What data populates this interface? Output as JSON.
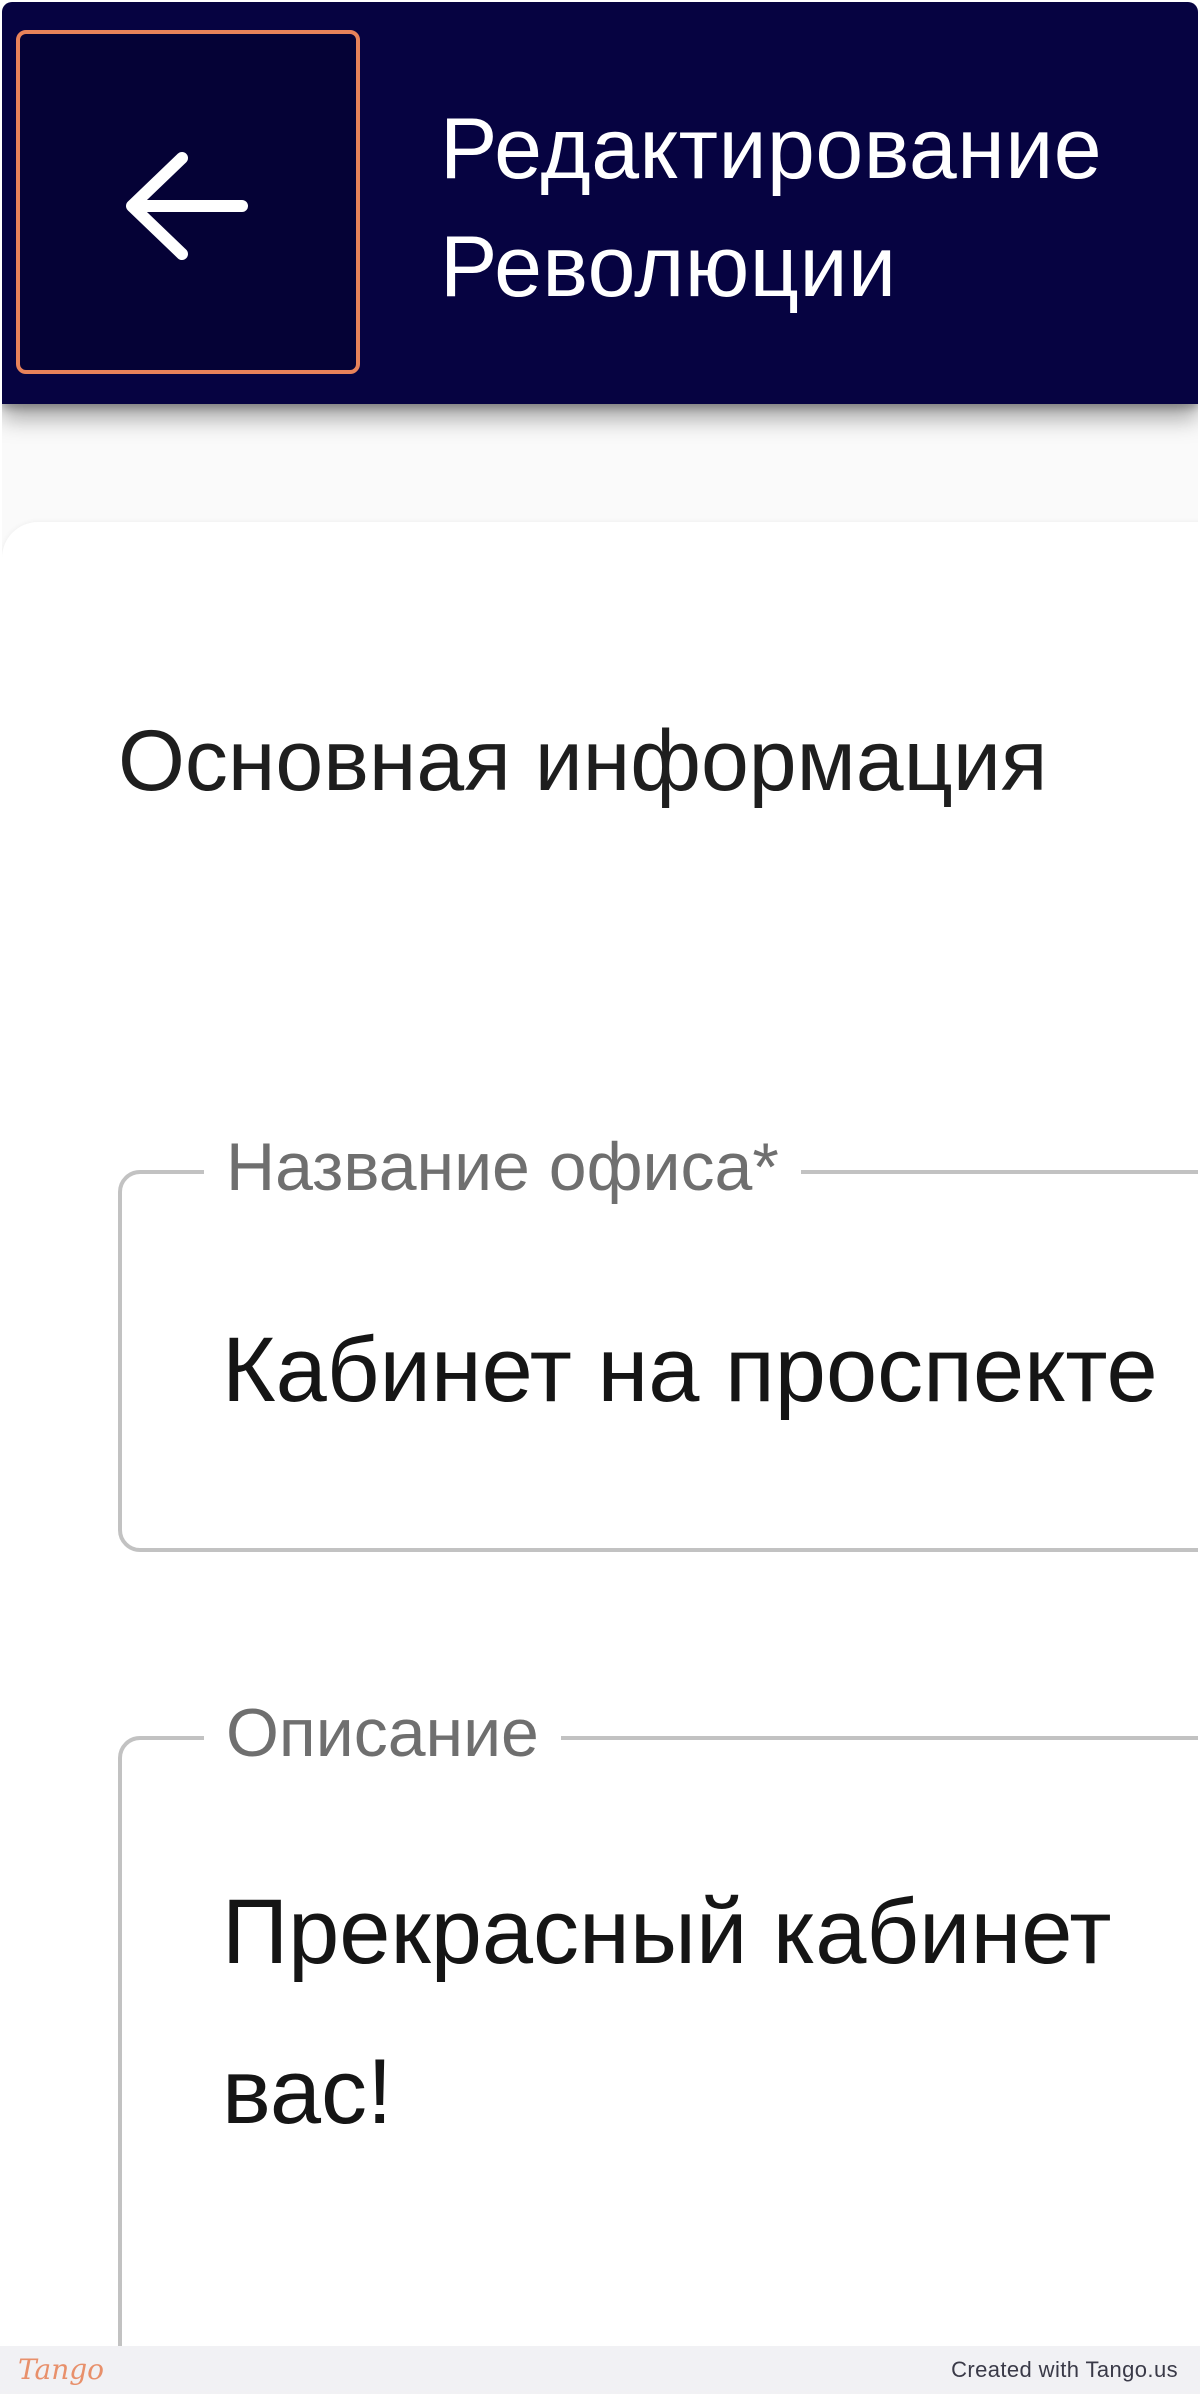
{
  "header": {
    "title": "Редактирование\nРеволюции",
    "back_icon": "arrow-left-icon",
    "back_focus_color": "#e8825a",
    "background_color": "#060341"
  },
  "main": {
    "section_title": "Основная информация",
    "fields": {
      "office_name": {
        "label": "Название офиса*",
        "value": "Кабинет на проспекте"
      },
      "description": {
        "label": "Описание",
        "value": "Прекрасный кабинет\nвас!"
      }
    }
  },
  "footer": {
    "logo": "Tango",
    "credit": "Created with Tango.us"
  }
}
